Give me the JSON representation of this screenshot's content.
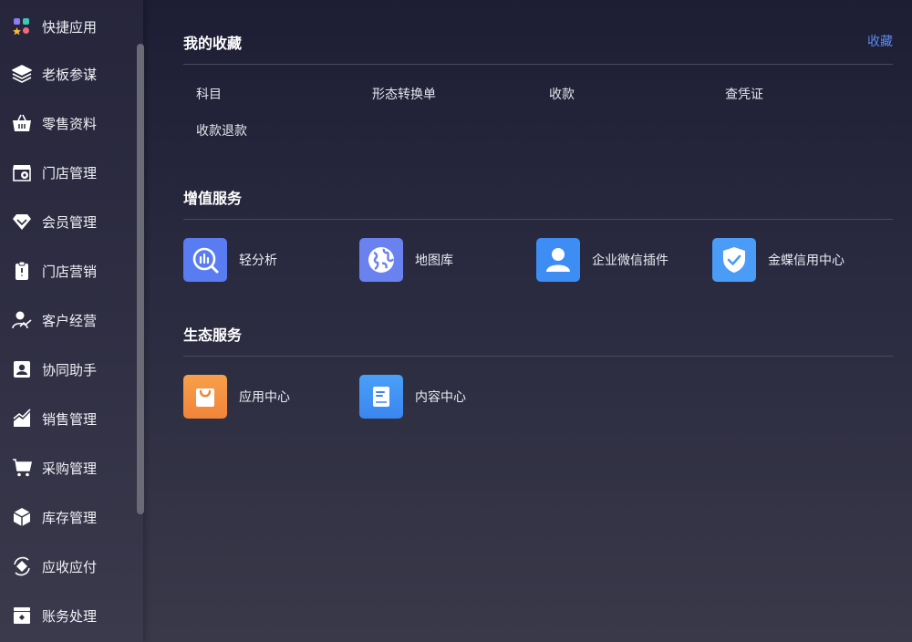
{
  "sidebar": {
    "items": [
      {
        "label": "快捷应用"
      },
      {
        "label": "老板参谋"
      },
      {
        "label": "零售资料"
      },
      {
        "label": "门店管理"
      },
      {
        "label": "会员管理"
      },
      {
        "label": "门店营销"
      },
      {
        "label": "客户经营"
      },
      {
        "label": "协同助手"
      },
      {
        "label": "销售管理"
      },
      {
        "label": "采购管理"
      },
      {
        "label": "库存管理"
      },
      {
        "label": "应收应付"
      },
      {
        "label": "账务处理"
      }
    ]
  },
  "favorites": {
    "title": "我的收藏",
    "action_label": "收藏",
    "items": [
      {
        "label": "科目"
      },
      {
        "label": "形态转换单"
      },
      {
        "label": "收款"
      },
      {
        "label": "查凭证"
      },
      {
        "label": "收款退款"
      }
    ]
  },
  "value_services": {
    "title": "增值服务",
    "items": [
      {
        "label": "轻分析",
        "icon": "analytics-icon",
        "color": "#5a7cf2"
      },
      {
        "label": "地图库",
        "icon": "globe-icon",
        "color": "#6a82f0"
      },
      {
        "label": "企业微信插件",
        "icon": "user-icon",
        "color": "#3d8df5"
      },
      {
        "label": "金蝶信用中心",
        "icon": "shield-check-icon",
        "color": "#4a9cf6"
      }
    ]
  },
  "eco_services": {
    "title": "生态服务",
    "items": [
      {
        "label": "应用中心",
        "icon": "shopping-bag-icon",
        "color": "#f4913a"
      },
      {
        "label": "内容中心",
        "icon": "document-icon",
        "color": "#3f90f3"
      }
    ]
  }
}
